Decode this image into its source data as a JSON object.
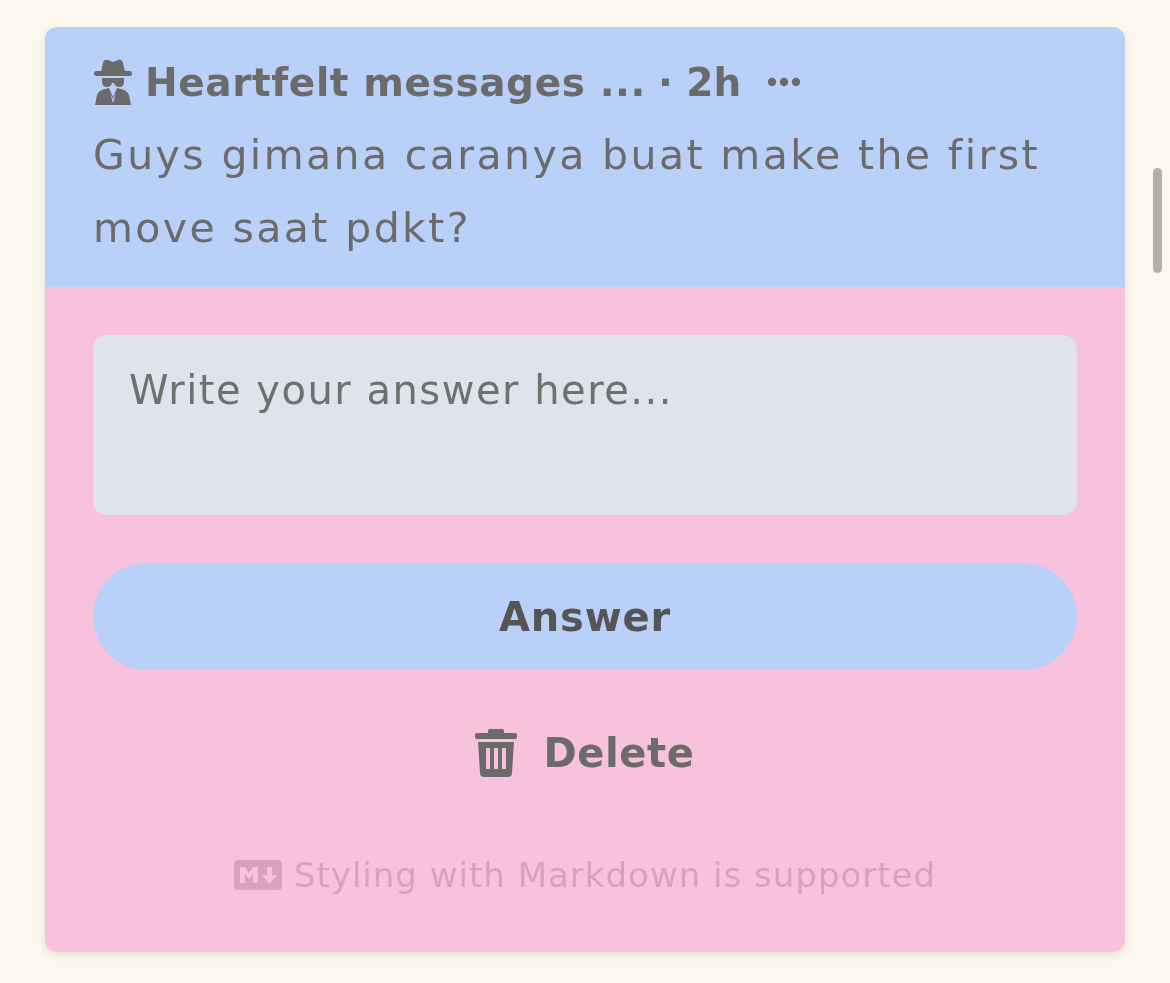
{
  "post": {
    "author": "Heartfelt messages ...",
    "meta": "· 2h",
    "message": "Guys gimana caranya buat make the first move saat pdkt?"
  },
  "answer": {
    "placeholder": "Write your answer here...",
    "submit": "Answer",
    "delete": "Delete",
    "hint": "Styling with Markdown is supported"
  }
}
